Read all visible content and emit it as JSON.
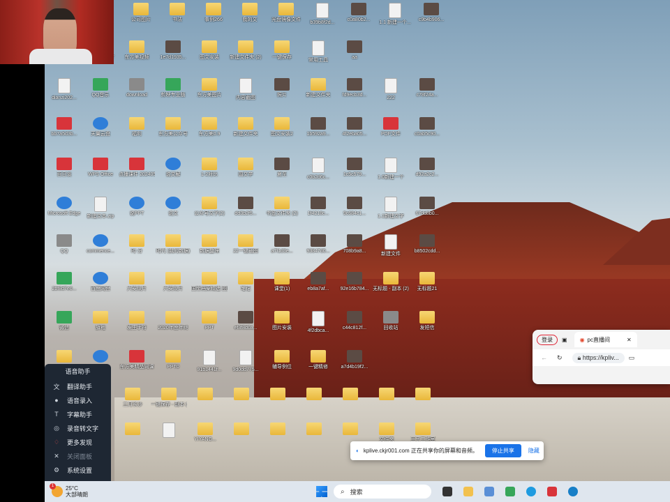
{
  "desktop_icons": [
    {
      "label": "公司图片",
      "kind": "folder"
    },
    {
      "label": "书法",
      "kind": "folder"
    },
    {
      "label": "事例266",
      "kind": "folder"
    },
    {
      "label": "我的文",
      "kind": "folder"
    },
    {
      "label": "光盘镜像文件",
      "kind": "folder"
    },
    {
      "label": "b39b8f2d...",
      "kind": "doc"
    },
    {
      "label": "c0a80b2...",
      "kind": "img"
    },
    {
      "label": "1.1 新建一个...",
      "kind": "doc"
    },
    {
      "label": "c9b4b906...",
      "kind": "img"
    },
    {
      "label": "dianzis",
      "kind": "folder"
    },
    {
      "label": "YIYANGPPT",
      "kind": "folder"
    },
    {
      "label": "东方美视频",
      "kind": "folder"
    },
    {
      "label": "1e7d1935...",
      "kind": "img"
    },
    {
      "label": "图文安装",
      "kind": "folder"
    },
    {
      "label": "新建文件夹 (2)",
      "kind": "folder"
    },
    {
      "label": "一键保存",
      "kind": "folder"
    },
    {
      "label": "常用工具",
      "kind": "doc"
    },
    {
      "label": "aa",
      "kind": "img"
    },
    {
      "label": "dianzi202...",
      "kind": "doc"
    },
    {
      "label": "QQ音乐",
      "kind": "app-green"
    },
    {
      "label": "download",
      "kind": "app-gray"
    },
    {
      "label": "剪映专业版",
      "kind": "app-green"
    },
    {
      "label": "东方美图片",
      "kind": "folder"
    },
    {
      "label": "内容截图",
      "kind": "doc"
    },
    {
      "label": "照片",
      "kind": "img"
    },
    {
      "label": "新建文件夹",
      "kind": "folder"
    },
    {
      "label": "fd9ecb3d...",
      "kind": "img"
    },
    {
      "label": "222",
      "kind": "doc"
    },
    {
      "label": "c78f24a...",
      "kind": "img"
    },
    {
      "label": "bb7a5d3b...",
      "kind": "app-red"
    },
    {
      "label": "天翼云盘",
      "kind": "app-blue"
    },
    {
      "label": "福利",
      "kind": "folder"
    },
    {
      "label": "东方美公众号",
      "kind": "folder"
    },
    {
      "label": "东方美0.9",
      "kind": "folder"
    },
    {
      "label": "新建文件夹",
      "kind": "folder"
    },
    {
      "label": "图文安装2",
      "kind": "folder"
    },
    {
      "label": "1b592a9...",
      "kind": "img"
    },
    {
      "label": "4f2eba05...",
      "kind": "img"
    },
    {
      "label": "PDF文件",
      "kind": "app-red"
    },
    {
      "label": "c0ab5c90...",
      "kind": "img"
    },
    {
      "label": "百日谈",
      "kind": "app-red"
    },
    {
      "label": "WPS Office",
      "kind": "app-red"
    },
    {
      "label": "点播课件 20240529",
      "kind": "app-red"
    },
    {
      "label": "说文解",
      "kind": "app-blue"
    },
    {
      "label": "1-2对比",
      "kind": "folder"
    },
    {
      "label": "国文学",
      "kind": "folder"
    },
    {
      "label": "夏至",
      "kind": "img"
    },
    {
      "label": "c0b2d6c...",
      "kind": "doc"
    },
    {
      "label": "1c5c579...",
      "kind": "img"
    },
    {
      "label": "1.0新建一个",
      "kind": "doc"
    },
    {
      "label": "d92a2c2...",
      "kind": "img"
    },
    {
      "label": "Microsoft Edge",
      "kind": "app-blue"
    },
    {
      "label": "新建文本.zip",
      "kind": "doc"
    },
    {
      "label": "说PPT",
      "kind": "app-blue"
    },
    {
      "label": "说文",
      "kind": "app-blue"
    },
    {
      "label": "公众号文字(2)",
      "kind": "folder"
    },
    {
      "label": "dd3b2f5...",
      "kind": "img"
    },
    {
      "label": "书签文件夹 (2)",
      "kind": "folder"
    },
    {
      "label": "1f4218c...",
      "kind": "img"
    },
    {
      "label": "9c684c1...",
      "kind": "img"
    },
    {
      "label": "1.1新建文字",
      "kind": "doc"
    },
    {
      "label": "67dd8b0...",
      "kind": "img"
    },
    {
      "label": "QQ",
      "kind": "app-gray"
    },
    {
      "label": "commence...",
      "kind": "app-blue"
    },
    {
      "label": "时·分",
      "kind": "folder"
    },
    {
      "label": "时代 (我的数据)",
      "kind": "folder"
    },
    {
      "label": "数据整理",
      "kind": "folder"
    },
    {
      "label": "22一键截图",
      "kind": "folder"
    },
    {
      "label": "a7f1d3e...",
      "kind": "img"
    },
    {
      "label": "93847d0...",
      "kind": "img"
    },
    {
      "label": "708b9a8...",
      "kind": "img"
    },
    {
      "label": "新建文件",
      "kind": "doc"
    },
    {
      "label": "b8502cdd...",
      "kind": "img"
    },
    {
      "label": "2bf8d7e0...",
      "kind": "app-green"
    },
    {
      "label": "百度网盘",
      "kind": "app-blue"
    },
    {
      "label": "六安瓜片",
      "kind": "folder"
    },
    {
      "label": "六安瓜片",
      "kind": "folder"
    },
    {
      "label": "国宝档案精选 图片",
      "kind": "folder"
    },
    {
      "label": "笔记",
      "kind": "folder"
    },
    {
      "label": "课堂(1)",
      "kind": "folder"
    },
    {
      "label": "eb8a7af...",
      "kind": "img"
    },
    {
      "label": "92e16b784...",
      "kind": "img"
    },
    {
      "label": "无标题 - 副本 (2)",
      "kind": "folder"
    },
    {
      "label": "无标题21",
      "kind": "folder"
    },
    {
      "label": "微信",
      "kind": "app-green"
    },
    {
      "label": "旗袍",
      "kind": "folder"
    },
    {
      "label": "发生字符",
      "kind": "folder"
    },
    {
      "label": "2020年度年终",
      "kind": "folder"
    },
    {
      "label": "PPT",
      "kind": "folder"
    },
    {
      "label": "ef3f8d0a...",
      "kind": "img"
    },
    {
      "label": "图片安装",
      "kind": "folder"
    },
    {
      "label": "4f2dbca...",
      "kind": "doc"
    },
    {
      "label": "c44c812f...",
      "kind": "img"
    },
    {
      "label": "回收站",
      "kind": "app-gray"
    },
    {
      "label": "发短信",
      "kind": "folder"
    },
    {
      "label": "整理",
      "kind": "folder"
    },
    {
      "label": "W...",
      "kind": "app-blue"
    },
    {
      "label": "东方美精品网课",
      "kind": "app-red"
    },
    {
      "label": "PPT0",
      "kind": "folder"
    },
    {
      "label": "91b1441f...",
      "kind": "doc"
    },
    {
      "label": "9d0dd775...",
      "kind": "doc"
    },
    {
      "label": "辅导例位",
      "kind": "folder"
    },
    {
      "label": "一键精修",
      "kind": "folder"
    },
    {
      "label": "a7d4b19f2...",
      "kind": "img"
    },
    {
      "label": "三月长沙",
      "kind": "folder"
    },
    {
      "label": "一键保存 - 副本 (3)",
      "kind": "folder"
    },
    {
      "label": "",
      "kind": "folder"
    },
    {
      "label": "",
      "kind": "folder"
    },
    {
      "label": "",
      "kind": "folder"
    },
    {
      "label": "",
      "kind": "folder"
    },
    {
      "label": "",
      "kind": "folder"
    },
    {
      "label": "",
      "kind": "folder"
    },
    {
      "label": "",
      "kind": "folder"
    },
    {
      "label": "",
      "kind": "folder"
    },
    {
      "label": "",
      "kind": "doc"
    },
    {
      "label": "YIYANG...",
      "kind": "folder"
    },
    {
      "label": "",
      "kind": "folder"
    },
    {
      "label": "",
      "kind": "folder"
    },
    {
      "label": "",
      "kind": "folder"
    },
    {
      "label": "",
      "kind": "folder"
    },
    {
      "label": "文件夹",
      "kind": "folder"
    },
    {
      "label": "王子工作室",
      "kind": "folder"
    }
  ],
  "side_menu": {
    "header": "语音助手",
    "items": [
      {
        "label": "翻译助手",
        "icon": "translate-icon",
        "dim": false
      },
      {
        "label": "语音录入",
        "icon": "mic-icon",
        "dim": false
      },
      {
        "label": "字幕助手",
        "icon": "subtitle-icon",
        "dim": false
      },
      {
        "label": "录音转文字",
        "icon": "record-icon",
        "dim": false
      },
      {
        "label": "更多发现",
        "icon": "discover-icon",
        "dim": false
      },
      {
        "label": "关闭面板",
        "icon": "close-icon",
        "dim": true
      },
      {
        "label": "系统设置",
        "icon": "gear-icon",
        "dim": false
      }
    ]
  },
  "browser": {
    "login_label": "登录",
    "tab_title": "pc直播间",
    "url": "https://kpliv..."
  },
  "share_bar": {
    "message": "kplive.ckjr001.com 正在共享你的屏幕和音频。",
    "stop_label": "停止共享",
    "hide_label": "隐藏"
  },
  "taskbar": {
    "weather_badge": "1",
    "temperature": "25°C",
    "weather_text": "大部晴朗",
    "search_placeholder": "搜索"
  },
  "colors": {
    "share_button": "#1a73e8",
    "taskbar_bg": "#dfe6ee",
    "menu_bg": "#1e2733"
  }
}
